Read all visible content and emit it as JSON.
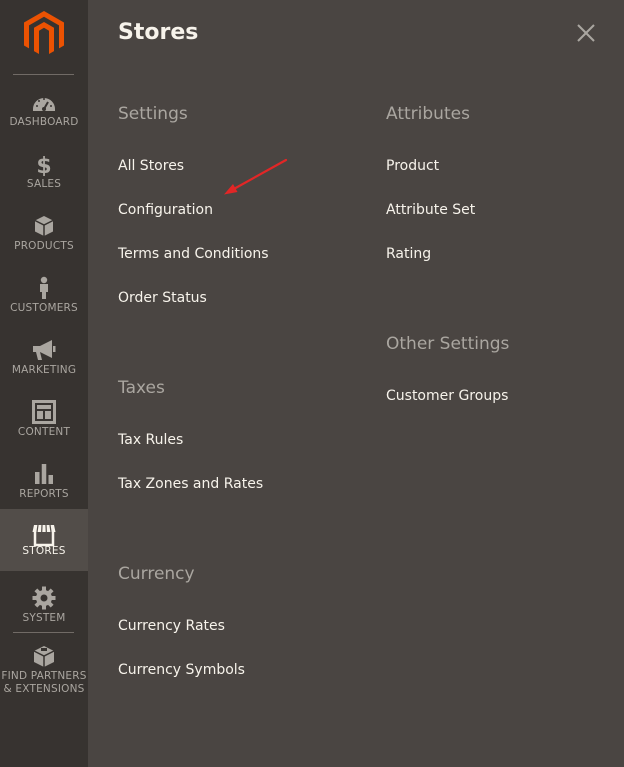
{
  "sidebar": {
    "logo": "magento-logo",
    "items": [
      {
        "label": "DASHBOARD",
        "icon": "dashboard-icon"
      },
      {
        "label": "SALES",
        "icon": "dollar-icon"
      },
      {
        "label": "PRODUCTS",
        "icon": "cube-icon"
      },
      {
        "label": "CUSTOMERS",
        "icon": "person-icon"
      },
      {
        "label": "MARKETING",
        "icon": "megaphone-icon"
      },
      {
        "label": "CONTENT",
        "icon": "layout-icon"
      },
      {
        "label": "REPORTS",
        "icon": "bar-chart-icon"
      },
      {
        "label": "STORES",
        "icon": "storefront-icon",
        "active": true
      },
      {
        "label": "SYSTEM",
        "icon": "gear-icon"
      },
      {
        "label": "FIND PARTNERS\n& EXTENSIONS",
        "line1": "FIND PARTNERS",
        "line2": "& EXTENSIONS",
        "icon": "extensions-icon"
      }
    ]
  },
  "panel": {
    "title": "Stores",
    "close_icon": "close-icon",
    "left_column": {
      "settings": {
        "title": "Settings",
        "links": [
          "All Stores",
          "Configuration",
          "Terms and Conditions",
          "Order Status"
        ]
      },
      "taxes": {
        "title": "Taxes",
        "links": [
          "Tax Rules",
          "Tax Zones and Rates"
        ]
      },
      "currency": {
        "title": "Currency",
        "links": [
          "Currency Rates",
          "Currency Symbols"
        ]
      }
    },
    "right_column": {
      "attributes": {
        "title": "Attributes",
        "links": [
          "Product",
          "Attribute Set",
          "Rating"
        ]
      },
      "other_settings": {
        "title": "Other Settings",
        "links": [
          "Customer Groups"
        ]
      }
    }
  },
  "colors": {
    "sidebar_bg": "#373330",
    "panel_bg": "#4a4542",
    "active_bg": "#524d49",
    "brand_orange": "#eb5202",
    "annotation_red": "#e22626"
  }
}
